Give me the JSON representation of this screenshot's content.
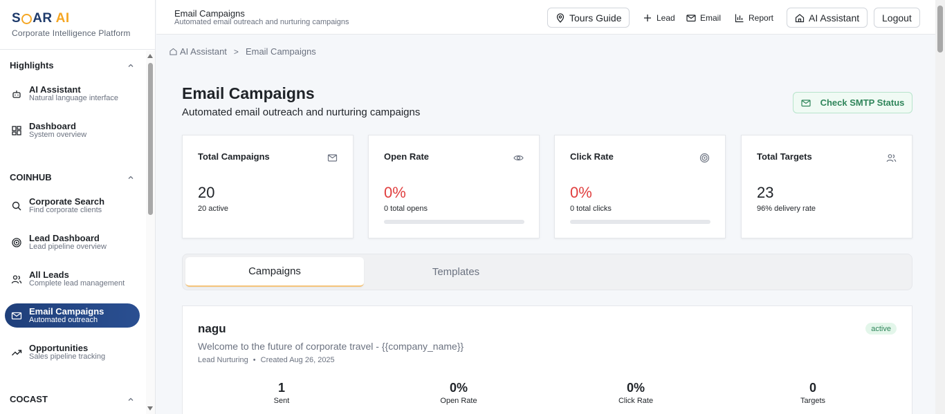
{
  "brand": {
    "name_part1": "S",
    "name_part2": "AR",
    "name_ai": "AI",
    "subtitle": "Corporate Intelligence Platform"
  },
  "sidebar": {
    "sections": [
      {
        "title": "Highlights"
      },
      {
        "title": "COINHUB"
      },
      {
        "title": "COCAST"
      }
    ],
    "items": [
      {
        "label": "AI Assistant",
        "sub": "Natural language interface",
        "icon": "bot-icon"
      },
      {
        "label": "Dashboard",
        "sub": "System overview",
        "icon": "dashboard-icon"
      },
      {
        "label": "Corporate Search",
        "sub": "Find corporate clients",
        "icon": "search-icon"
      },
      {
        "label": "Lead Dashboard",
        "sub": "Lead pipeline overview",
        "icon": "target-icon"
      },
      {
        "label": "All Leads",
        "sub": "Complete lead management",
        "icon": "users-icon"
      },
      {
        "label": "Email Campaigns",
        "sub": "Automated outreach",
        "icon": "mail-icon"
      },
      {
        "label": "Opportunities",
        "sub": "Sales pipeline tracking",
        "icon": "trending-up-icon"
      }
    ],
    "active_index": 5
  },
  "topbar": {
    "title": "Email Campaigns",
    "subtitle": "Automated email outreach and nurturing campaigns",
    "tours_label": "Tours Guide",
    "lead_label": "Lead",
    "email_label": "Email",
    "report_label": "Report",
    "assistant_label": "AI Assistant",
    "logout_label": "Logout"
  },
  "breadcrumb": {
    "root": "AI Assistant",
    "separator": ">",
    "current": "Email Campaigns"
  },
  "page": {
    "title": "Email Campaigns",
    "subtitle": "Automated email outreach and nurturing campaigns",
    "smtp_label": "Check SMTP Status"
  },
  "stats": [
    {
      "label": "Total Campaigns",
      "value": "20",
      "note": "20 active",
      "icon": "mail-icon"
    },
    {
      "label": "Open Rate",
      "value": "0%",
      "note": "0 total opens",
      "icon": "eye-icon",
      "progress": 0
    },
    {
      "label": "Click Rate",
      "value": "0%",
      "note": "0 total clicks",
      "icon": "target-icon",
      "progress": 0
    },
    {
      "label": "Total Targets",
      "value": "23",
      "note": "96% delivery rate",
      "icon": "users-icon"
    }
  ],
  "tabs": [
    {
      "label": "Campaigns",
      "active": true
    },
    {
      "label": "Templates",
      "active": false
    }
  ],
  "campaign": {
    "name": "nagu",
    "status": "active",
    "subject": "Welcome to the future of corporate travel - {{company_name}}",
    "type": "Lead Nurturing",
    "created": "Created Aug 26, 2025",
    "metrics": [
      {
        "value": "1",
        "label": "Sent"
      },
      {
        "value": "0%",
        "label": "Open Rate"
      },
      {
        "value": "0%",
        "label": "Click Rate"
      },
      {
        "value": "0",
        "label": "Targets"
      }
    ]
  },
  "colors": {
    "accent": "#1f3f7a",
    "brand_orange": "#f5a623",
    "danger": "#e03e3e",
    "success": "#2f855a"
  }
}
